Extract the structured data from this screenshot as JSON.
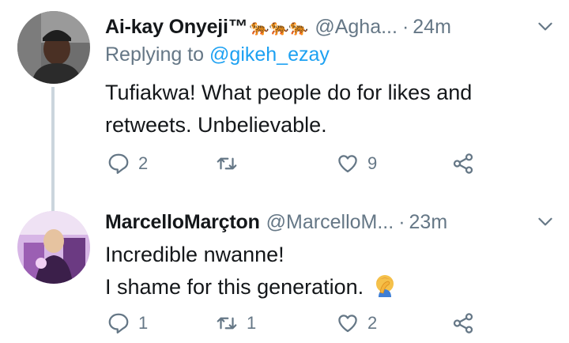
{
  "tweets": [
    {
      "display_name": "Ai-kay Onyeji™",
      "name_emojis": "🐅🐅🐅",
      "handle": "@Agha...",
      "separator": "·",
      "time": "24m",
      "reply_prefix": "Replying to",
      "reply_mention": "@gikeh_ezay",
      "text_lines": [
        "Tufiakwa! What people do for likes and",
        "retweets. Unbelievable."
      ],
      "reply_count": "2",
      "retweet_count": "",
      "like_count": "9"
    },
    {
      "display_name": "MarcelloMarçton",
      "handle": "@MarcelloM...",
      "separator": "·",
      "time": "23m",
      "text_lines": [
        "Incredible nwanne!",
        "I shame for this generation."
      ],
      "text_emoji": "🤦",
      "reply_count": "1",
      "retweet_count": "1",
      "like_count": "2"
    }
  ],
  "icons": {
    "reply": "reply-icon",
    "retweet": "retweet-icon",
    "like": "heart-icon",
    "share": "share-icon",
    "more": "chevron-down-icon"
  },
  "colors": {
    "text": "#14171a",
    "secondary": "#657786",
    "link": "#1da1f2",
    "thread_line": "#cbd5dd"
  }
}
